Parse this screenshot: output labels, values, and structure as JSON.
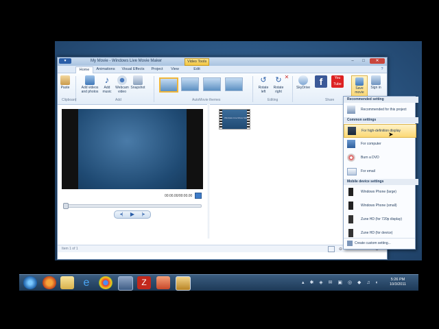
{
  "window": {
    "title": "My Movie - Windows Live Movie Maker",
    "context_tab": "Video Tools",
    "controls": [
      "–",
      "□",
      "✕"
    ]
  },
  "tabs": [
    "Home",
    "Animations",
    "Visual Effects",
    "Project",
    "View",
    "Edit"
  ],
  "ribbon": {
    "paste": "Paste",
    "add_videos": "Add videos and photos",
    "add_music": "Add music",
    "webcam": "Webcam video",
    "snapshot": "Snapshot",
    "rotate_left": "Rotate left",
    "rotate_right": "Rotate right",
    "skydrive": "SkyDrive",
    "youtube": "You Tube",
    "save_movie": "Save movie",
    "sign_in": "Sign in",
    "groups": [
      "Clipboard",
      "Add",
      "AutoMovie themes",
      "Editing",
      "Share"
    ]
  },
  "player": {
    "timecode": "00:00.00/00:00.00"
  },
  "storyboard": {
    "clip_text": "Windows Live Movie Maker"
  },
  "status": {
    "text": "Item 1 of 1"
  },
  "save_menu": {
    "recommended_header": "Recommended setting",
    "recommended": "Recommended for this project",
    "common_header": "Common settings",
    "hd": "For high-definition display",
    "computer": "For computer",
    "dvd": "Burn a DVD",
    "email": "For email",
    "mobile_header": "Mobile device settings",
    "wp_large": "Windows Phone (large)",
    "wp_small": "Windows Phone (small)",
    "zune_hd": "Zune HD (for 720p display)",
    "zune_device": "Zune HD (for device)",
    "custom": "Create custom setting..."
  },
  "taskbar": {
    "time": "5:26 PM",
    "date": "10/3/2011"
  }
}
